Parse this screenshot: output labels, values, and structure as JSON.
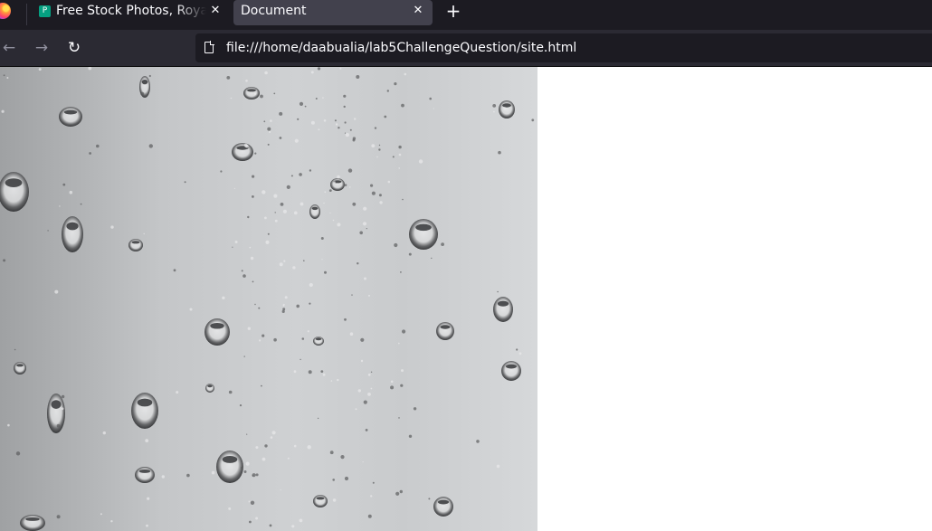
{
  "browser": {
    "tabs": [
      {
        "title": "Free Stock Photos, Royalty Free Stock Images",
        "favicon": "P",
        "active": false
      },
      {
        "title": "Document",
        "active": true
      }
    ],
    "newtab_label": "+",
    "close_glyph": "✕",
    "nav": {
      "back_glyph": "←",
      "forward_glyph": "→",
      "reload_glyph": "↻"
    },
    "url": "file:///home/daabualia/lab5ChallengeQuestion/site.html"
  },
  "page": {
    "image": {
      "description_icon": "raindrops-photo",
      "tone": "grayscale"
    }
  },
  "colors": {
    "tabstrip": "#1c1b22",
    "active_tab": "#42414d",
    "navbar": "#2b2a33",
    "urlbar": "#1c1b22",
    "favicon": "#05a081",
    "page_background": "#ffffff"
  }
}
